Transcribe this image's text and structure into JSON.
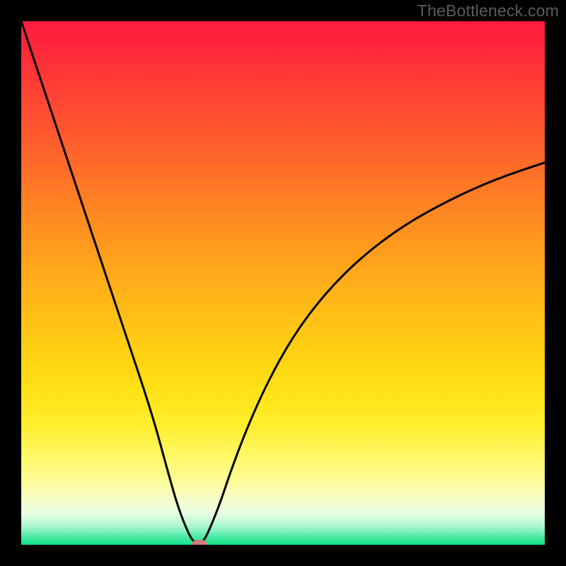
{
  "watermark": "TheBottleneck.com",
  "chart_data": {
    "type": "line",
    "title": "",
    "xlabel": "",
    "ylabel": "",
    "xlim": [
      0,
      100
    ],
    "ylim": [
      0,
      100
    ],
    "grid": false,
    "legend": false,
    "background": "rainbow-gradient-vertical",
    "series": [
      {
        "name": "bottleneck-curve",
        "color": "#000000",
        "x": [
          0,
          5,
          10,
          15,
          20,
          25,
          28,
          30,
          32,
          33,
          34,
          35,
          36,
          38,
          40,
          43,
          47,
          52,
          58,
          65,
          73,
          82,
          91,
          100
        ],
        "values": [
          100,
          85,
          70,
          55,
          40,
          25,
          14,
          7,
          2,
          0.5,
          0,
          1,
          3,
          8,
          14,
          22,
          31,
          40,
          48,
          55,
          61,
          66,
          70,
          73
        ]
      }
    ],
    "marker": {
      "x": 34,
      "y": 0,
      "color": "#cf7d7d"
    },
    "gradient_stops": [
      {
        "pct": 0,
        "color": "#ff1a3f"
      },
      {
        "pct": 50,
        "color": "#ffce13"
      },
      {
        "pct": 88,
        "color": "#fcfc99"
      },
      {
        "pct": 100,
        "color": "#15e086"
      }
    ]
  }
}
